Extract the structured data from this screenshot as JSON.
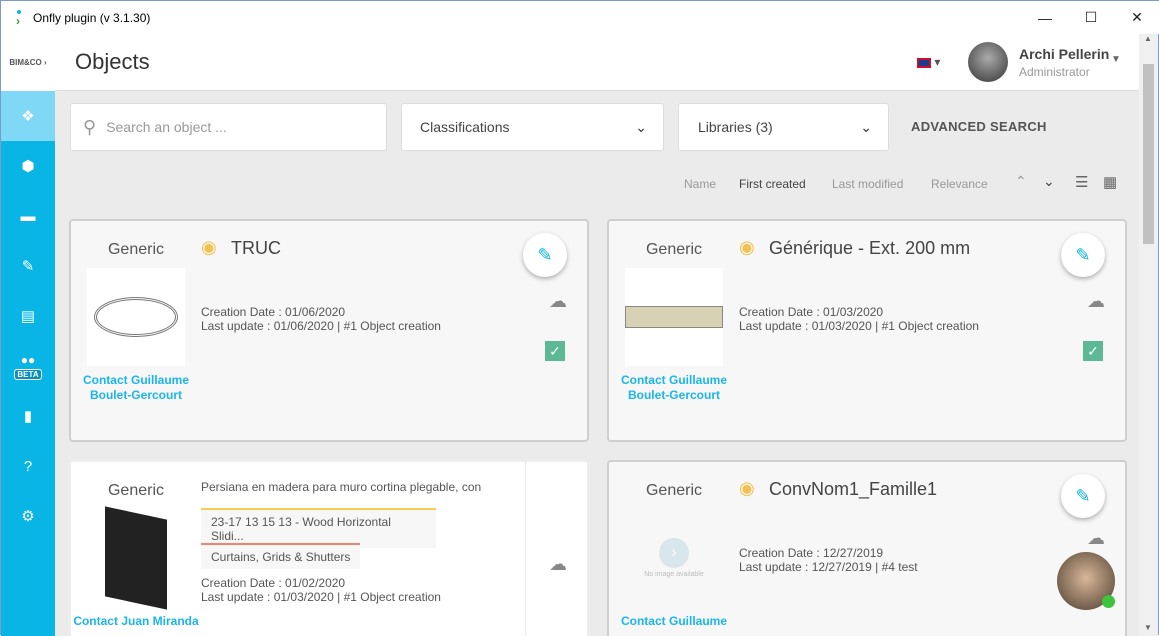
{
  "window": {
    "title": "Onfly plugin (v 3.1.30)",
    "minimize": "—",
    "maximize": "☐",
    "close": "✕"
  },
  "sidebar": {
    "logo": "BIM&CO",
    "beta": "BETA"
  },
  "header": {
    "title": "Objects",
    "user_name": "Archi Pellerin",
    "user_role": "Administrator"
  },
  "search": {
    "placeholder": "Search an object ...",
    "classifications": "Classifications",
    "libraries": "Libraries (3)",
    "advanced": "ADVANCED SEARCH"
  },
  "sort": {
    "name": "Name",
    "first_created": "First created",
    "last_modified": "Last modified",
    "relevance": "Relevance"
  },
  "cards": [
    {
      "type": "Generic",
      "title": "TRUC",
      "creation": "Creation Date : 01/06/2020",
      "update": "Last update : 01/06/2020 | #1 Object creation",
      "contact": "Contact Guillaume Boulet-Gercourt"
    },
    {
      "type": "Generic",
      "title": "Générique - Ext. 200 mm",
      "creation": "Creation Date : 01/03/2020",
      "update": "Last update : 01/03/2020 | #1 Object creation",
      "contact": "Contact Guillaume Boulet-Gercourt"
    },
    {
      "type": "Generic",
      "description": "Persiana en madera para muro cortina plegable, con",
      "tag1": "23-17 13 15 13 - Wood Horizontal Slidi...",
      "tag2": "Curtains, Grids & Shutters",
      "creation": "Creation Date : 01/02/2020",
      "update": "Last update : 01/03/2020 | #1 Object creation",
      "contact": "Contact Juan Miranda"
    },
    {
      "type": "Generic",
      "title": "ConvNom1_Famille1",
      "creation": "Creation Date : 12/27/2019",
      "update": "Last update : 12/27/2019 | #4 test",
      "contact": "Contact Guillaume",
      "no_image": "No image available"
    }
  ]
}
